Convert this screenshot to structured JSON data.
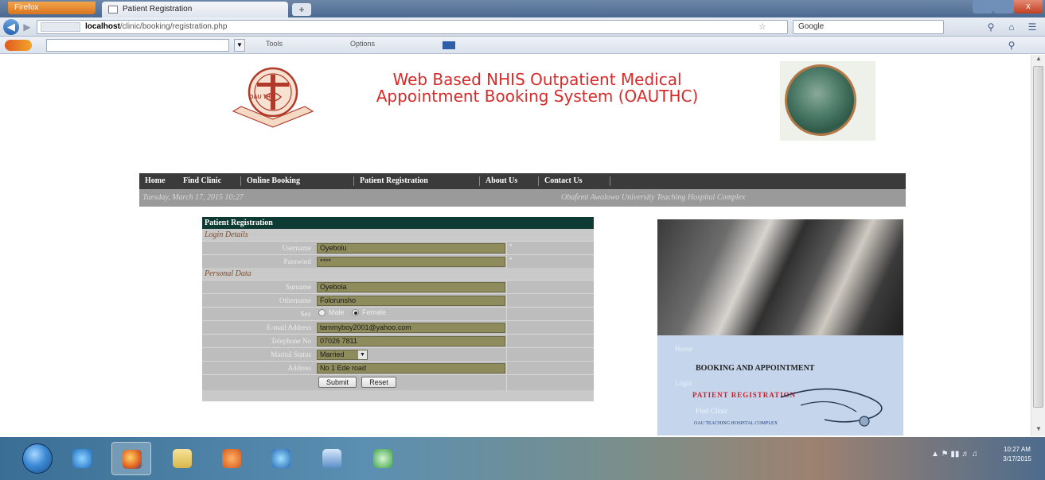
{
  "browser": {
    "menu_button": "Firefox",
    "tab_title": "Patient Registration",
    "new_tab_label": "+",
    "close_label": "x",
    "url_host": "localhost",
    "url_path": "/clinic/booking/registration.php",
    "search_engine_label": "Google",
    "toolbar_text_1": "Tools",
    "toolbar_text_2": "Options"
  },
  "site": {
    "title": "Web Based NHIS Outpatient Medical Appointment Booking System (OAUTHC)",
    "logo_left_text": "OAU THC",
    "menu": [
      "Home",
      "Find Clinic",
      "Online Booking",
      "Patient Registration",
      "About Us",
      "Contact Us"
    ],
    "date_text": "Tuesday, March 17, 2015 10:27",
    "hospital_text": "Obafemi Awolowo University Teaching Hospital Complex"
  },
  "form": {
    "header": "Patient Registration",
    "section_login": "Login Details",
    "section_personal": "Personal Data",
    "labels": {
      "username": "Username",
      "password": "Password",
      "surname": "Surname",
      "othername": "Othername",
      "sex": "Sex",
      "email": "E-mail Address",
      "phone": "Telephone No",
      "marital": "Marital Status",
      "address": "Address"
    },
    "values": {
      "username": "Oyebolu",
      "password": "****",
      "surname": "Oyebola",
      "othername": "Folorunsho",
      "email": "tammyboy2001@yahoo.com",
      "phone": "07026 7811",
      "marital": "Married",
      "address": "No 1 Ede road"
    },
    "required_marker": "*",
    "sex_options": [
      "Male",
      "Female"
    ],
    "sex_selected": "Female",
    "submit_label": "Submit",
    "reset_label": "Reset"
  },
  "side_panel": {
    "link_1": "Home",
    "booking_title": "BOOKING AND APPOINTMENT",
    "link_2": "Login",
    "patient_title": "PATIENT REGISTRATION",
    "link_3": "Find Clinic",
    "footer": "OAU TEACHING HOSPITAL COMPLEX"
  },
  "taskbar": {
    "clock_time": "10:27 AM",
    "clock_date": "3/17/2015"
  },
  "colors": {
    "title_red": "#d92a2a",
    "menu_dark": "#3b3b3b",
    "form_header": "#0d3a33",
    "field_olive": "#8e8b5c",
    "panel_blue": "#c5d6ec"
  }
}
